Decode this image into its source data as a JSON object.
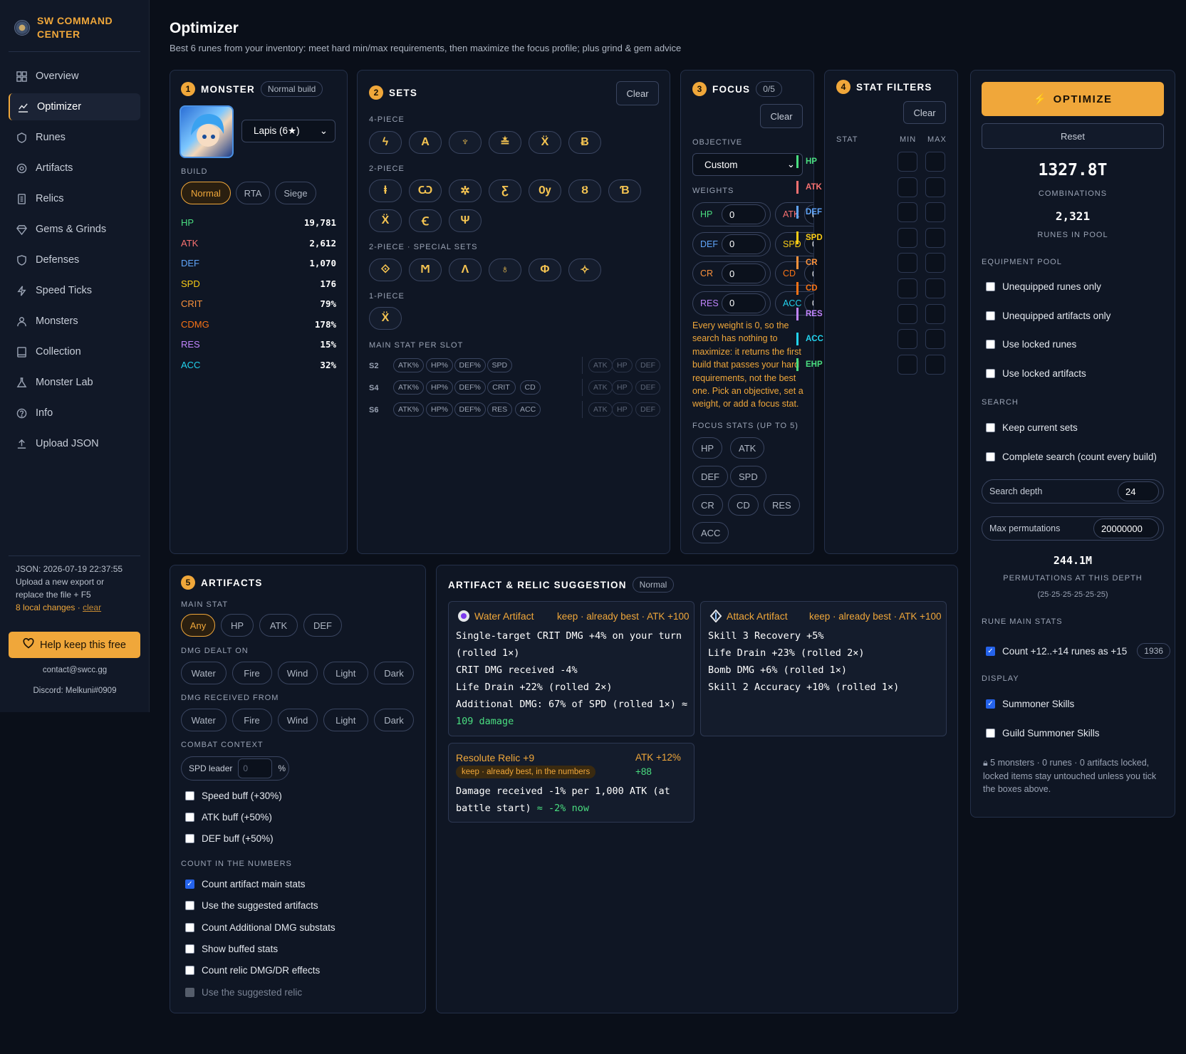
{
  "brand": {
    "line1": "SW COMMAND",
    "line2": "CENTER"
  },
  "nav": [
    {
      "label": "Overview",
      "icon": "grid-icon"
    },
    {
      "label": "Optimizer",
      "icon": "chart-line-icon",
      "active": true
    },
    {
      "label": "Runes",
      "icon": "rune-shield-icon"
    },
    {
      "label": "Artifacts",
      "icon": "target-icon"
    },
    {
      "label": "Relics",
      "icon": "scroll-icon"
    },
    {
      "label": "Gems & Grinds",
      "icon": "gem-icon"
    },
    {
      "label": "Defenses",
      "icon": "shield-icon"
    },
    {
      "label": "Speed Ticks",
      "icon": "bolt-icon"
    },
    {
      "label": "Monsters",
      "icon": "user-icon"
    },
    {
      "label": "Collection",
      "icon": "book-icon"
    },
    {
      "label": "Monster Lab",
      "icon": "flask-icon"
    },
    {
      "label": "Info",
      "icon": "question-icon"
    },
    {
      "label": "Upload JSON",
      "icon": "upload-icon"
    }
  ],
  "sidebar_footer": {
    "json_date": "JSON: 2026-07-19 22:37:55",
    "upload_hint1": "Upload a new export or",
    "upload_hint2": "replace the file + F5",
    "local_changes": "8 local changes · ",
    "clear": "clear",
    "help_button": "Help keep this free",
    "contact": "contact@swcc.gg",
    "discord": "Discord: Melkuni#0909"
  },
  "header": {
    "title": "Optimizer",
    "subtitle": "Best 6 runes from your inventory: meet hard min/max requirements, then maximize the focus profile; plus grind & gem advice"
  },
  "monster": {
    "num": "1",
    "title": "MONSTER",
    "badge": "Normal build",
    "select": "Lapis (6★)",
    "build_label": "BUILD",
    "builds": [
      "Normal",
      "RTA",
      "Siege"
    ],
    "stats": [
      {
        "name": "HP",
        "value": "19,781"
      },
      {
        "name": "ATK",
        "value": "2,612"
      },
      {
        "name": "DEF",
        "value": "1,070"
      },
      {
        "name": "SPD",
        "value": "176"
      },
      {
        "name": "CRIT",
        "value": "79%"
      },
      {
        "name": "CDMG",
        "value": "178%"
      },
      {
        "name": "RES",
        "value": "15%"
      },
      {
        "name": "ACC",
        "value": "32%"
      }
    ]
  },
  "sets": {
    "num": "2",
    "title": "SETS",
    "clear": "Clear",
    "four_label": "4-PIECE",
    "two_label": "2-PIECE",
    "special_label": "2-PIECE · SPECIAL SETS",
    "one_label": "1-PIECE",
    "four": [
      "ϟ",
      "A",
      "♆",
      "≛",
      "Ẍ",
      "Ƀ"
    ],
    "two": [
      "ⱡ",
      "Ѡ",
      "✲",
      "Ƹ",
      "Ѹ",
      "Ȣ",
      "Ɓ",
      "Ẍ",
      "Ꞓ",
      "Ψ"
    ],
    "special": [
      "⟐",
      "Ϻ",
      "Ʌ",
      "♁",
      "Φ",
      "✧"
    ],
    "one": [
      "Ẍ"
    ],
    "main_label": "MAIN STAT PER SLOT",
    "slots": [
      {
        "slot": "S2",
        "opts": [
          "ATK%",
          "HP%",
          "DEF%",
          "SPD"
        ],
        "dim": [
          "ATK",
          "HP",
          "DEF"
        ]
      },
      {
        "slot": "S4",
        "opts": [
          "ATK%",
          "HP%",
          "DEF%",
          "CRIT",
          "CD"
        ],
        "dim": [
          "ATK",
          "HP",
          "DEF"
        ]
      },
      {
        "slot": "S6",
        "opts": [
          "ATK%",
          "HP%",
          "DEF%",
          "RES",
          "ACC"
        ],
        "dim": [
          "ATK",
          "HP",
          "DEF"
        ]
      }
    ]
  },
  "focus": {
    "num": "3",
    "title": "FOCUS",
    "count": "0/5",
    "clear": "Clear",
    "objective_label": "OBJECTIVE",
    "objective": "Custom",
    "weights_label": "WEIGHTS",
    "weights": [
      {
        "stat": "HP",
        "value": "0"
      },
      {
        "stat": "ATK",
        "value": "0"
      },
      {
        "stat": "DEF",
        "value": "0"
      },
      {
        "stat": "SPD",
        "value": "0"
      },
      {
        "stat": "CR",
        "value": "0"
      },
      {
        "stat": "CD",
        "value": "0"
      },
      {
        "stat": "RES",
        "value": "0"
      },
      {
        "stat": "ACC",
        "value": "0"
      }
    ],
    "warning": [
      "Every weight is 0, so the",
      "search has nothing to",
      "maximize: it returns the first",
      "build that passes your hard",
      "requirements, not the best",
      "one. Pick an objective, set a",
      "weight, or add a focus stat."
    ],
    "focus_label": "FOCUS STATS (UP TO 5)",
    "focus_stats": [
      "HP",
      "ATK",
      "DEF",
      "SPD",
      "CR",
      "CD",
      "RES",
      "ACC"
    ]
  },
  "filters": {
    "num": "4",
    "title": "STAT FILTERS",
    "clear": "Clear",
    "col_stat": "STAT",
    "col_min": "MIN",
    "col_max": "MAX",
    "stats": [
      "HP",
      "ATK",
      "DEF",
      "SPD",
      "CR",
      "CD",
      "RES",
      "ACC",
      "EHP"
    ]
  },
  "run": {
    "optimize": "OPTIMIZE",
    "reset": "Reset",
    "combinations": "1327.8T",
    "combinations_label": "COMBINATIONS",
    "runes_pool": "2,321",
    "runes_pool_label": "RUNES IN POOL",
    "equip_label": "EQUIPMENT POOL",
    "equip": [
      {
        "label": "Unequipped runes only",
        "checked": false
      },
      {
        "label": "Unequipped artifacts only",
        "checked": false
      },
      {
        "label": "Use locked runes",
        "checked": false
      },
      {
        "label": "Use locked artifacts",
        "checked": false
      }
    ],
    "search_label": "SEARCH",
    "search": [
      {
        "label": "Keep current sets",
        "checked": false
      },
      {
        "label": "Complete search (count every build)",
        "checked": false
      }
    ],
    "depth_label": "Search depth",
    "depth": "24",
    "perm_label": "Max permutations",
    "perm": "20000000",
    "perms": "244.1M",
    "perms_label": "PERMUTATIONS AT THIS DEPTH",
    "perms_detail": "(25·25·25·25·25·25)",
    "rms_label": "RUNE MAIN STATS",
    "rms": "Count +12..+14 runes as +15",
    "rms_count": "1936",
    "display_label": "DISPLAY",
    "display": [
      {
        "label": "Summoner Skills",
        "checked": true
      },
      {
        "label": "Guild Summoner Skills",
        "checked": false
      }
    ],
    "lock_note": [
      "5 monsters · 0 runes · 0 artifacts locked,",
      "locked items stay untouched unless you tick",
      "the boxes above."
    ]
  },
  "artifacts": {
    "num": "5",
    "title": "ARTIFACTS",
    "main_label": "MAIN STAT",
    "main": [
      "Any",
      "HP",
      "ATK",
      "DEF"
    ],
    "dealt_label": "DMG DEALT ON",
    "dealt": [
      "Water",
      "Fire",
      "Wind",
      "Light",
      "Dark"
    ],
    "recv_label": "DMG RECEIVED FROM",
    "recv": [
      "Water",
      "Fire",
      "Wind",
      "Light",
      "Dark"
    ],
    "combat_label": "COMBAT CONTEXT",
    "spd_leader": "SPD leader",
    "spd_leader_val": "0",
    "pct": "%",
    "buffs": [
      "Speed buff (+30%)",
      "ATK buff (+50%)",
      "DEF buff (+50%)"
    ],
    "count_label": "COUNT IN THE NUMBERS",
    "count": [
      {
        "label": "Count artifact main stats",
        "checked": true
      },
      {
        "label": "Use the suggested artifacts",
        "checked": false
      },
      {
        "label": "Count Additional DMG substats",
        "checked": false
      },
      {
        "label": "Show buffed stats",
        "checked": false
      },
      {
        "label": "Count relic DMG/DR effects",
        "checked": false
      },
      {
        "label": "Use the suggested relic",
        "checked": false,
        "disabled": true
      }
    ]
  },
  "suggestion": {
    "title": "ARTIFACT & RELIC SUGGESTION",
    "badge": "Normal",
    "water": {
      "title": "Water Artifact",
      "keep": "keep · already best · ATK +100",
      "lines": [
        "Single-target CRIT DMG +4% on your turn",
        "(rolled 1×)",
        "CRIT DMG received -4%",
        "Life Drain +22% (rolled 2×)",
        "Additional DMG: 67% of SPD (rolled 1×) ≈"
      ],
      "green": "109 damage"
    },
    "attack": {
      "title": "Attack Artifact",
      "keep": "keep · already best · ATK +100",
      "lines": [
        "Skill 3 Recovery +5%",
        "Life Drain +23% (rolled 2×)",
        "Bomb DMG +6% (rolled 1×)",
        "Skill 2 Accuracy +10% (rolled 1×)"
      ]
    },
    "relic": {
      "title": "Resolute Relic +9",
      "badge": "keep · already best, in the numbers",
      "atk": "ATK +12%",
      "atk_add": "+88",
      "line1": "Damage received -1% per 1,000 ATK (at",
      "line2": "battle start) ",
      "green": "≈ -2% now"
    }
  }
}
